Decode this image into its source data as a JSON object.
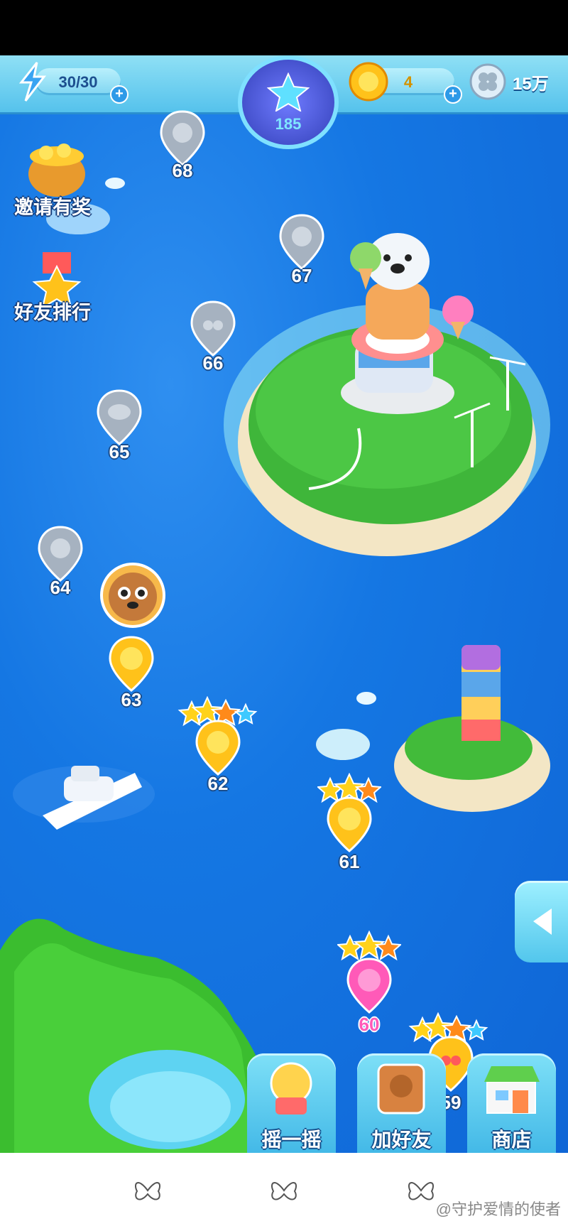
{
  "hud": {
    "energy": "30/30",
    "total_stars": "185",
    "gold_coins": "4",
    "clover_count": "15万"
  },
  "side_menu": {
    "invite": "邀请有奖",
    "ranking": "好友排行"
  },
  "levels": {
    "l59": "59",
    "l60": "60",
    "l61": "61",
    "l62": "62",
    "l63": "63",
    "l64": "64",
    "l65": "65",
    "l66": "66",
    "l67": "67",
    "l68": "68"
  },
  "bottom_buttons": {
    "shake": "摇一摇",
    "add_friend": "加好友",
    "shop": "商店"
  },
  "watermark": "@守护爱情的使者",
  "colors": {
    "ocean": "#1577e3",
    "hud": "#6fd0f0",
    "pink_level": "#ff5ab8",
    "gold": "#ffc21a"
  }
}
